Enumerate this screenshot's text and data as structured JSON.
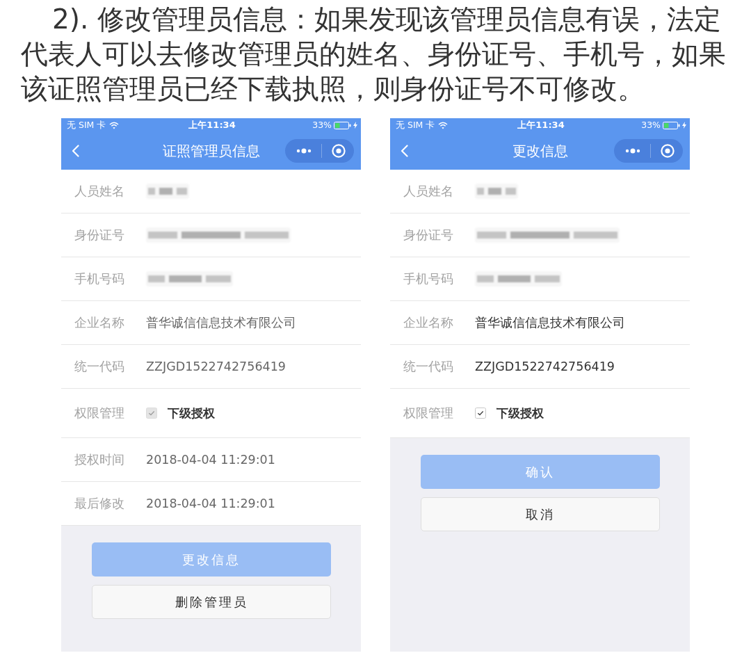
{
  "description": "2). 修改管理员信息：如果发现该管理员信息有误，法定代表人可以去修改管理员的姓名、身份证号、手机号，如果该证照管理员已经下载执照，则身份证号不可修改。",
  "screens": [
    {
      "kind": "detail",
      "status_bar": {
        "carrier": "无 SIM 卡",
        "time": "上午11:34",
        "battery": "33%"
      },
      "nav_bar": {
        "title": "证照管理员信息"
      },
      "rows": [
        {
          "kind": "redacted",
          "label": "人员姓名"
        },
        {
          "kind": "redacted",
          "label": "身份证号"
        },
        {
          "kind": "redacted",
          "label": "手机号码"
        },
        {
          "kind": "text",
          "label": "企业名称",
          "value": "普华诚信信息技术有限公司"
        },
        {
          "kind": "text",
          "label": "统一代码",
          "value": "ZZJGD1522742756419"
        },
        {
          "kind": "checkbox",
          "label": "权限管理",
          "option": "下级授权",
          "checked": true,
          "disabled": true
        },
        {
          "kind": "text",
          "label": "授权时间",
          "value": "2018-04-04 11:29:01"
        },
        {
          "kind": "text",
          "label": "最后修改",
          "value": "2018-04-04 11:29:01"
        }
      ],
      "buttons": [
        {
          "kind": "primary",
          "label": "更改信息"
        },
        {
          "kind": "default",
          "label": "删除管理员"
        }
      ]
    },
    {
      "kind": "form",
      "status_bar": {
        "carrier": "无 SIM 卡",
        "time": "上午11:34",
        "battery": "33%"
      },
      "nav_bar": {
        "title": "更改信息"
      },
      "rows": [
        {
          "kind": "redacted",
          "label": "人员姓名"
        },
        {
          "kind": "redacted",
          "label": "身份证号"
        },
        {
          "kind": "redacted",
          "label": "手机号码"
        },
        {
          "kind": "text",
          "label": "企业名称",
          "value": "普华诚信信息技术有限公司"
        },
        {
          "kind": "text",
          "label": "统一代码",
          "value": "ZZJGD1522742756419"
        },
        {
          "kind": "checkbox",
          "label": "权限管理",
          "option": "下级授权",
          "checked": true,
          "disabled": false
        }
      ],
      "buttons": [
        {
          "kind": "primary",
          "label": "确认"
        },
        {
          "kind": "default",
          "label": "取消"
        }
      ]
    }
  ]
}
